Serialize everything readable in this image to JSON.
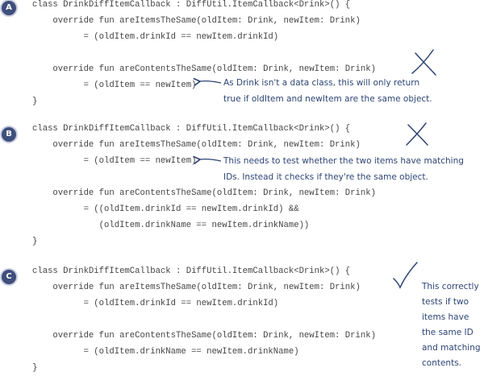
{
  "sections": [
    {
      "badge": "A",
      "code": [
        "class DrinkDiffItemCallback : DiffUtil.ItemCallback<Drink>() {",
        "    override fun areItemsTheSame(oldItem: Drink, newItem: Drink)",
        "          = (oldItem.drinkId == newItem.drinkId)",
        "",
        "    override fun areContentsTheSame(oldItem: Drink, newItem: Drink)",
        "          = (oldItem == newItem)",
        "}"
      ],
      "mark": "cross",
      "note": [
        "As Drink isn't a data class, this will only return",
        "true if oldItem and newItem are the same object."
      ]
    },
    {
      "badge": "B",
      "code": [
        "class DrinkDiffItemCallback : DiffUtil.ItemCallback<Drink>() {",
        "    override fun areItemsTheSame(oldItem: Drink, newItem: Drink)",
        "          = (oldItem == newItem)",
        "",
        "    override fun areContentsTheSame(oldItem: Drink, newItem: Drink)",
        "          = ((oldItem.drinkId == newItem.drinkId) &&",
        "             (oldItem.drinkName == newItem.drinkName))",
        "}"
      ],
      "mark": "cross",
      "note": [
        "This needs to test whether the two items have matching",
        "IDs. Instead it checks if they're the same object."
      ]
    },
    {
      "badge": "C",
      "code": [
        "class DrinkDiffItemCallback : DiffUtil.ItemCallback<Drink>() {",
        "    override fun areItemsTheSame(oldItem: Drink, newItem: Drink)",
        "          = (oldItem.drinkId == newItem.drinkId)",
        "",
        "    override fun areContentsTheSame(oldItem: Drink, newItem: Drink)",
        "          = (oldItem.drinkName == newItem.drinkName)",
        "}"
      ],
      "mark": "check",
      "note": [
        "This correctly",
        "tests if two",
        "items have",
        "the same ID",
        "and matching",
        "contents."
      ]
    }
  ],
  "colors": {
    "badge": "#3f4f7c",
    "code": "#444444",
    "handwriting": "#2d4474"
  },
  "icons": {
    "cross_mark": "x-mark-icon",
    "check_mark": "check-mark-icon",
    "pointer_arrow": "arrow-left-icon"
  }
}
